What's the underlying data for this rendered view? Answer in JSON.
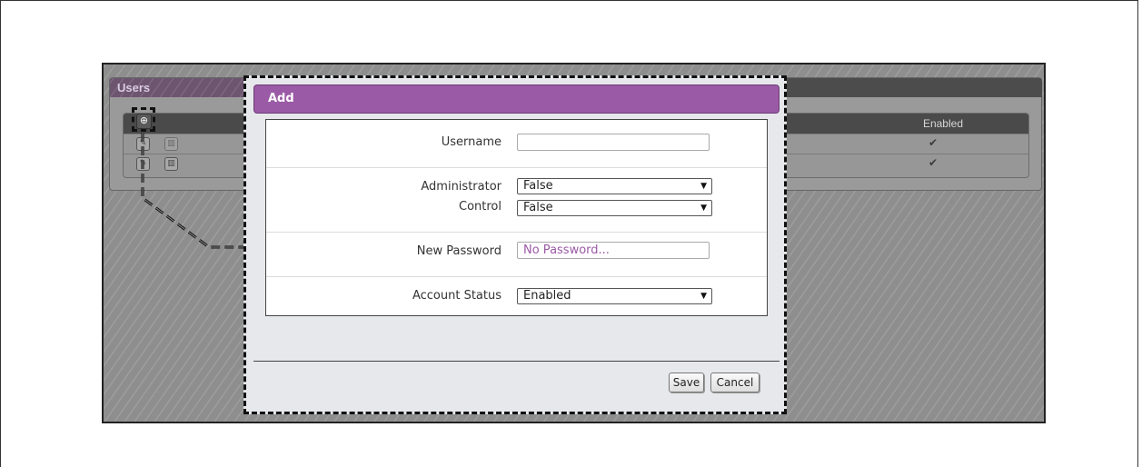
{
  "users_panel": {
    "title": "Users",
    "columns": {
      "enabled": "Enabled"
    },
    "rows": [
      {
        "enabled": "✔"
      },
      {
        "enabled": "✔"
      }
    ]
  },
  "modal": {
    "title": "Add",
    "fields": {
      "username": {
        "label": "Username",
        "value": ""
      },
      "administrator": {
        "label": "Administrator",
        "value": "False"
      },
      "control": {
        "label": "Control",
        "value": "False"
      },
      "new_password": {
        "label": "New Password",
        "placeholder": "No Password..."
      },
      "account_status": {
        "label": "Account Status",
        "value": "Enabled"
      }
    },
    "buttons": {
      "save": "Save",
      "cancel": "Cancel"
    }
  },
  "icons": {
    "add": "plus-circle-icon",
    "edit": "edit-icon",
    "delete": "trash-icon",
    "check": "checkmark-icon",
    "dropdown": "chevron-down-icon"
  },
  "colors": {
    "modal_header": "#9b5aa6",
    "placeholder": "#9b5aa6"
  }
}
